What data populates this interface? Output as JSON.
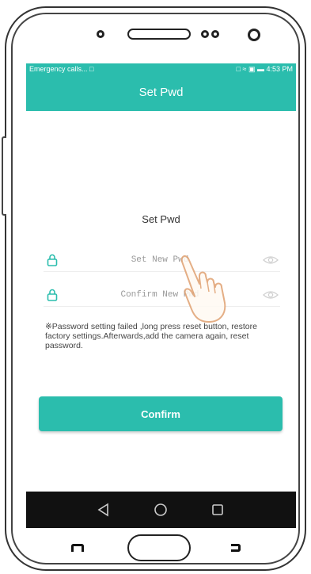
{
  "status_bar": {
    "left_text": "Emergency calls... □",
    "right_text": "□ ≈ ▣ ▬ 4:53 PM"
  },
  "header": {
    "title": "Set Pwd"
  },
  "form": {
    "section_title": "Set Pwd",
    "new_password": {
      "placeholder": "Set New Pwd"
    },
    "confirm_password": {
      "placeholder": "Confirm New Pwd"
    },
    "note": "※Password setting failed ,long press reset button, restore factory settings.Afterwards,add the camera again, reset password.",
    "confirm_label": "Confirm"
  },
  "icons": {
    "lock": "lock-icon",
    "eye": "eye-icon",
    "nav_back": "back-triangle-icon",
    "nav_home": "home-circle-icon",
    "nav_recent": "recent-square-icon"
  },
  "colors": {
    "accent": "#2bbdad",
    "nav_bar": "#111111"
  }
}
